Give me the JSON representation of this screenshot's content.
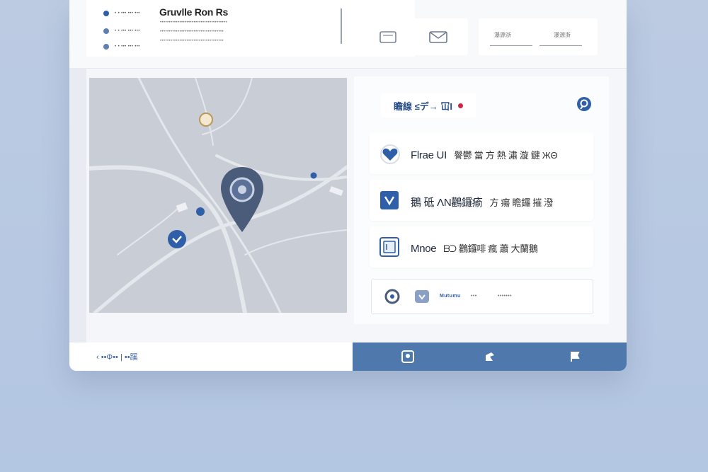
{
  "header": {
    "title": "Gruvlle Ron Rs",
    "legend": [
      {
        "label": "• • ••• ••• •••"
      },
      {
        "label": "• • ••• ••• •••"
      },
      {
        "label": "• • ••• ••• •••"
      }
    ],
    "text_lines": [
      "••••••••••••••••••••••••••••••••••••••",
      "••••••••••••••••••••••••••••••••••••",
      "••••••••••••••••••••••••••••••••••••"
    ],
    "options": [
      "瀑源浙",
      "瀑源浙"
    ]
  },
  "filter": {
    "label": "瞻線 ≤デ→ 冚I"
  },
  "items": [
    {
      "label": "Flrae UI",
      "sub": "譽鬱 當 方 熱 潚 漩 鍵 ЖΘ"
    },
    {
      "label": "鵝 砥 ΛΝ鸛鑼瘉",
      "sub": "方 瘍 瞻鑼 摧 潑"
    },
    {
      "label": "Mnoe",
      "sub": "ᗷᑐ 鸛鑼啡 瘋 蕭 大蘭鵝"
    }
  ],
  "small_card": {
    "name": "Mutumu",
    "meta1": "•••",
    "meta2": "•••••••"
  },
  "bottom": {
    "left_text": "‹ ••Φ•• | ••蹊"
  },
  "colors": {
    "accent": "#2f5fa8",
    "nav": "#4f79ad",
    "alert": "#d12440"
  }
}
